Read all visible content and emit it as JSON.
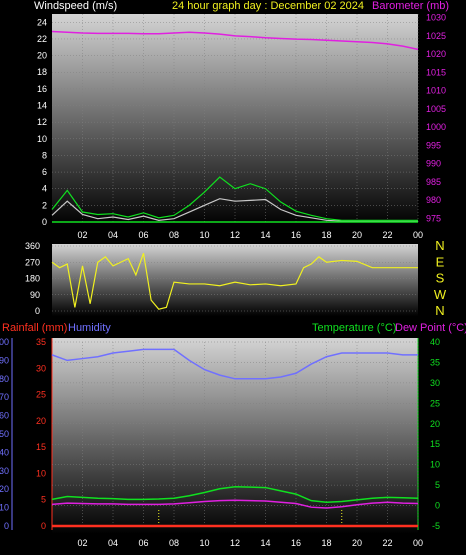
{
  "title": "24 hour graph day : December 02 2024",
  "colors": {
    "windspeed": "#c8c8c8",
    "windgust": "#10e020",
    "barometer": "#e020e0",
    "direction": "#f0f020",
    "rainfall": "#ff3020",
    "humidity": "#7070ff",
    "temperature": "#10e020",
    "dewpoint": "#e020e0",
    "grid": "#808080",
    "tick": "#ffffff"
  },
  "x_ticks": [
    "02",
    "04",
    "06",
    "08",
    "10",
    "12",
    "14",
    "16",
    "18",
    "20",
    "22",
    "00"
  ],
  "chart_data": [
    {
      "type": "line",
      "name": "wind-barometer",
      "ylabel_left": "Windspeed (m/s)",
      "ylabel_right": "Barometer (mb)",
      "left_ticks": [
        "0",
        "2",
        "4",
        "6",
        "8",
        "10",
        "12",
        "14",
        "16",
        "18",
        "20",
        "22",
        "24"
      ],
      "right_ticks": [
        "975",
        "980",
        "985",
        "990",
        "995",
        "1000",
        "1005",
        "1010",
        "1015",
        "1020",
        "1025",
        "1030"
      ],
      "ylim_left": [
        0,
        25
      ],
      "ylim_right": [
        974,
        1031
      ],
      "x_hours": [
        0,
        1,
        2,
        3,
        4,
        5,
        6,
        7,
        8,
        9,
        10,
        11,
        12,
        13,
        14,
        15,
        16,
        17,
        18,
        19,
        20,
        21,
        22,
        23,
        24
      ],
      "series": [
        {
          "name": "Barometer",
          "axis": "right",
          "values": [
            1026.2,
            1026.0,
            1025.8,
            1025.7,
            1025.7,
            1025.7,
            1025.6,
            1025.6,
            1025.8,
            1026.0,
            1025.8,
            1025.5,
            1025.0,
            1024.8,
            1024.5,
            1024.3,
            1024.1,
            1024.0,
            1023.8,
            1023.6,
            1023.4,
            1023.2,
            1022.8,
            1022.2,
            1021.3
          ]
        },
        {
          "name": "Wind speed",
          "axis": "left",
          "values": [
            0.8,
            2.5,
            0.9,
            0.4,
            0.6,
            0.3,
            0.7,
            0.2,
            0.4,
            1.2,
            2.0,
            2.8,
            2.5,
            2.6,
            2.7,
            1.5,
            0.8,
            0.5,
            0.2,
            0.1,
            0.1,
            0.1,
            0.1,
            0.1,
            0.1
          ]
        },
        {
          "name": "Wind gust",
          "axis": "left",
          "values": [
            1.5,
            3.8,
            1.2,
            0.9,
            1.0,
            0.6,
            1.1,
            0.5,
            0.8,
            2.0,
            3.6,
            5.4,
            4.0,
            4.6,
            4.0,
            2.4,
            1.3,
            0.8,
            0.4,
            0.2,
            0.2,
            0.2,
            0.2,
            0.2,
            0.2
          ]
        }
      ]
    },
    {
      "type": "line",
      "name": "wind-direction",
      "left_ticks": [
        "0",
        "90",
        "180",
        "270",
        "360"
      ],
      "compass": [
        "N",
        "W",
        "S",
        "E",
        "N"
      ],
      "ylim": [
        0,
        360
      ],
      "x_hours": [
        0,
        0.5,
        1,
        1.5,
        2,
        2.5,
        3,
        3.5,
        4,
        4.5,
        5,
        5.5,
        6,
        6.5,
        7,
        7.5,
        8,
        9,
        10,
        11,
        12,
        13,
        14,
        15,
        16,
        16.5,
        17,
        17.5,
        18,
        19,
        20,
        21,
        22,
        23,
        24
      ],
      "values": [
        270,
        240,
        260,
        20,
        250,
        40,
        270,
        300,
        250,
        270,
        290,
        200,
        320,
        60,
        10,
        20,
        160,
        150,
        150,
        140,
        160,
        145,
        150,
        140,
        150,
        240,
        260,
        300,
        270,
        280,
        275,
        240,
        240,
        240,
        240
      ]
    },
    {
      "type": "line",
      "name": "rain-humidity-temperature",
      "ylabel_left_1": "Rainfall (mm)",
      "ylabel_left_2": "Humidity",
      "ylabel_right_1": "Temperature (°C)",
      "ylabel_right_2": "Dew Point (°C)",
      "humidity_ticks": [
        "0",
        "10",
        "20",
        "30",
        "40",
        "50",
        "60",
        "70",
        "80",
        "90",
        "100"
      ],
      "rain_ticks": [
        "0",
        "5",
        "10",
        "15",
        "20",
        "25",
        "30",
        "35"
      ],
      "temp_ticks": [
        "-5",
        "0",
        "5",
        "10",
        "15",
        "20",
        "25",
        "30",
        "35",
        "40"
      ],
      "ylim_humidity": [
        0,
        100
      ],
      "ylim_rain": [
        0,
        35
      ],
      "ylim_temp": [
        -5,
        40
      ],
      "x_hours": [
        0,
        1,
        2,
        3,
        4,
        5,
        6,
        7,
        8,
        9,
        10,
        11,
        12,
        13,
        14,
        15,
        16,
        17,
        18,
        19,
        20,
        21,
        22,
        23,
        24
      ],
      "series": [
        {
          "name": "Humidity",
          "axis": "humidity",
          "values": [
            93,
            90,
            91,
            92,
            94,
            95,
            96,
            96,
            96,
            90,
            85,
            82,
            80,
            80,
            80,
            81,
            83,
            88,
            92,
            94,
            94,
            94,
            94,
            93,
            93
          ]
        },
        {
          "name": "Temperature",
          "axis": "temp",
          "values": [
            1.5,
            2.2,
            2.0,
            1.8,
            1.7,
            1.5,
            1.5,
            1.6,
            1.8,
            2.4,
            3.2,
            4.1,
            4.6,
            4.5,
            4.4,
            3.6,
            2.8,
            1.2,
            0.8,
            1.0,
            1.4,
            1.8,
            2.0,
            1.9,
            1.8
          ]
        },
        {
          "name": "Dew Point",
          "axis": "temp",
          "values": [
            0.3,
            0.6,
            0.5,
            0.4,
            0.4,
            0.3,
            0.3,
            0.3,
            0.4,
            0.7,
            1.0,
            1.2,
            1.3,
            1.2,
            1.1,
            0.8,
            0.5,
            -0.4,
            -0.6,
            -0.3,
            0.2,
            0.6,
            0.8,
            0.6,
            0.5
          ]
        },
        {
          "name": "Rainfall",
          "axis": "rain",
          "values": [
            0,
            0,
            0,
            0,
            0,
            0,
            0,
            0,
            0,
            0,
            0,
            0,
            0,
            0,
            0,
            0,
            0,
            0,
            0,
            0,
            0,
            0,
            0,
            0,
            0
          ]
        }
      ]
    }
  ]
}
